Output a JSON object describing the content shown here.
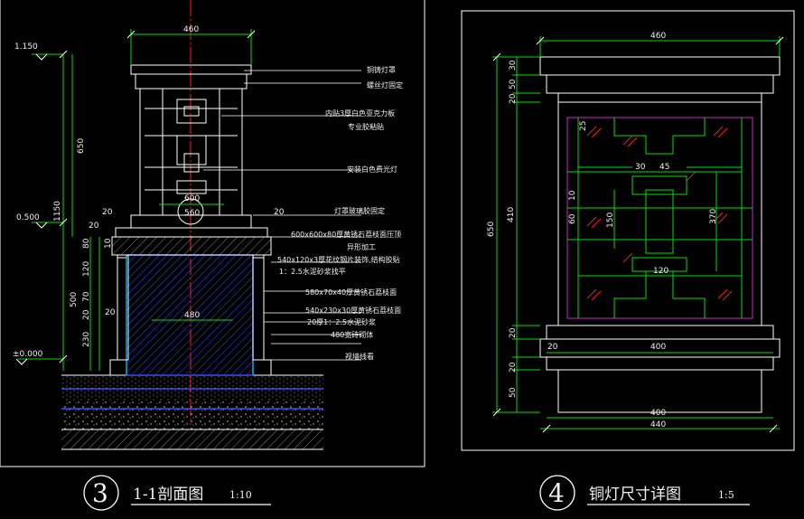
{
  "left_view": {
    "number": "3",
    "title": "1-1剖面图",
    "scale": "1:10",
    "elev_top": "1.150",
    "elev_mid": "0.500",
    "elev_base": "±0.000",
    "dims": {
      "top_width": "460",
      "d600": "600",
      "d560": "560",
      "d480": "480",
      "d20a": "20",
      "d20b": "20",
      "d20c": "20",
      "d20d": "20",
      "h650": "650",
      "h1150": "1150",
      "h500": "500",
      "h80": "80",
      "h10": "10",
      "h120": "120",
      "h70": "70",
      "h20": "20",
      "h230": "230"
    },
    "notes": [
      "铜铸灯罩",
      "螺丝灯固定",
      "内贴3厚白色亚克力板",
      "专业胶粘贴",
      "安装白色费光灯",
      "灯罩玻璃胶固定",
      "600x600x80厚黄锈石荔枝面压顶",
      "异形加工",
      "540x120x3厚花纹钢片装饰,结构胶贴",
      "1：2.5水泥砂浆找平",
      "580x70x40厚黄锈石荔枝面",
      "540x230x30厚黄锈石荔枝面",
      "20厚1：2.5水泥砂浆",
      "480宽砖砌体",
      "视墙线看"
    ]
  },
  "right_view": {
    "number": "4",
    "title": "铜灯尺寸详图",
    "scale": "1:5",
    "dims": {
      "top_width": "460",
      "h650": "650",
      "h410": "410",
      "h30": "30",
      "h50a": "50",
      "h20a": "20",
      "h20b": "20",
      "h20c": "20",
      "h50b": "50",
      "w400a": "400",
      "w400b": "400",
      "w440": "440",
      "s20": "20",
      "s25": "25",
      "s30": "30",
      "s45": "45",
      "s10": "10",
      "s60": "60",
      "s150": "150",
      "s370": "370",
      "s120": "120"
    }
  },
  "colors": {
    "green": "#00e000",
    "cyan": "#00d8d8",
    "red": "#ff2020",
    "blue": "#3a4cff",
    "yellow": "#e8e800",
    "white": "#ffffff",
    "magenta": "#ff30ff"
  }
}
